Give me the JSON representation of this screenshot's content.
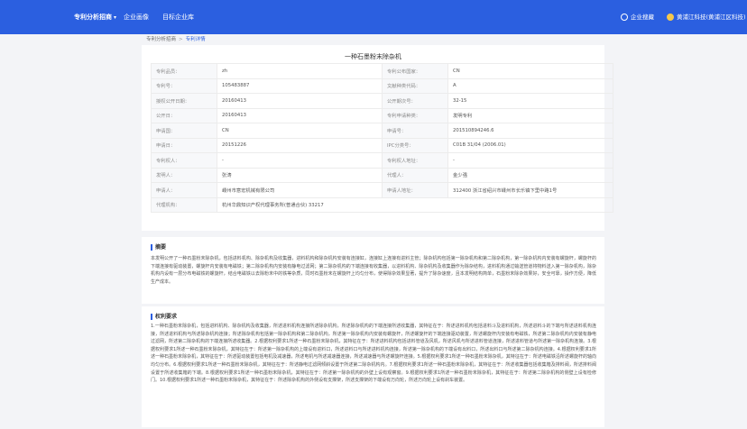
{
  "nav": {
    "items": [
      {
        "label": "专利分析招商"
      },
      {
        "label": "企业画像"
      },
      {
        "label": "目标企业库"
      }
    ],
    "right": {
      "favorites": "企业搜藏",
      "user": "黄浦江科技(黄浦江区科技)"
    }
  },
  "breadcrumb": {
    "parent": "专利分析招商",
    "current": "专利详情"
  },
  "detail": {
    "title": "一种石墨粉末除杂机",
    "rows": [
      [
        {
          "label": "专利品员：",
          "value": "zh"
        },
        {
          "label": "专利公布国家：",
          "value": "CN"
        }
      ],
      [
        {
          "label": "专利号：",
          "value": "105483887"
        },
        {
          "label": "文献种类代码：",
          "value": "A"
        }
      ],
      [
        {
          "label": "授权公开日期：",
          "value": "20160413"
        },
        {
          "label": "公开期次号：",
          "value": "32-15"
        }
      ],
      [
        {
          "label": "公开日：",
          "value": "20160413"
        },
        {
          "label": "专利申请种类：",
          "value": "发明专利"
        }
      ],
      [
        {
          "label": "申请国：",
          "value": "CN"
        },
        {
          "label": "申请号：",
          "value": "201510894246.6"
        }
      ],
      [
        {
          "label": "申请日：",
          "value": "20151226"
        },
        {
          "label": "IPC分类号：",
          "value": "C01B 31/04 (2006.01)"
        }
      ],
      [
        {
          "label": "专利权人：",
          "value": "-"
        },
        {
          "label": "专利权人地址：",
          "value": "-"
        }
      ],
      [
        {
          "label": "发明人：",
          "value": "张涛"
        },
        {
          "label": "代理人：",
          "value": "金少强"
        }
      ],
      [
        {
          "label": "申请人：",
          "value": "嵊州市意宏机械有限公司"
        },
        {
          "label": "申请人地址：",
          "value": "312400 浙江省绍兴市嵊州市长乐镇下里中路1号"
        }
      ]
    ],
    "agency_label": "代理机构：",
    "agency_value": "杭州华鼎知识产权代理事务所(普通合伙) 33217"
  },
  "abstract": {
    "title": "摘要",
    "text": "本发明公开了一种石墨粉末除杂机，包括进料机构、除杂机构及收集器，进料机构和除杂机构安装有连接缸，连接缸上连接有进料主管；除杂机构包括第一除杂机构和第二除杂机构，第一除杂机构内安装有螺旋杆，螺旋杆的下端连接有驱动装置，螺旋杆内安装有电磁铁；第二除杂机构内安装有静电过滤网；第二除杂机构的下端连接有收集器，以进料机构、除杂机构及收集器作为除杂结构，进料机构通过输送管道将物料送入第一除杂机构，除杂机构内设有一层分布电磁铁的螺旋杆，结合电磁铁以去除粉末中的铁等杂质，同时石墨粉末在螺旋杆上均匀分布，使得除杂效果显著，提升了除杂速度，且本发明结构简单，石墨粉末除杂效果好，安全可靠，操作方便，降低生产成本。"
  },
  "claims": {
    "title": "权利要求",
    "text": "1.一种石墨粉末除杂机，包括进料机构、除杂机构及收集器，所述进料机构连接所述除杂机构，所述除杂机构的下端连接所述收集器，其特征在于：所述进料机构包括进料斗及进料机构，所述进料斗的下端与所述进料机构连接，所述进料机构与所述除杂机构连接；所述除杂机构包括第一除杂机构和第二除杂机构，所述第一除杂机构内安装有螺旋杆，所述螺旋杆的下端连接驱动装置，所述螺旋杆内安装有电磁铁，所述第二除杂机构内安装有静电过滤网，所述第二除杂机构的下端连接所述收集器。2.根据权利要求1所述一种石墨粉末除杂机，其特征在于：所述进料机构包括进料管道及风机，所述风机与所述进料管道连接，所述进料管道与所述第一除杂机构连接。3.根据权利要求1所述一种石墨粉末除杂机，其特征在于：所述第一除杂机构的上端设有进料口，所述进料口与所述进料机构连接，所述第一除杂机构的下端设有出料口，所述出料口与所述第二除杂机构连接。4.根据权利要求1所述一种石墨粉末除杂机，其特征在于：所述驱动装置包括电机及减速器，所述电机与所述减速器连接，所述减速器与所述螺旋杆连接。5.根据权利要求1所述一种石墨粉末除杂机，其特征在于：所述电磁铁沿所述螺旋杆的轴向均匀分布。6.根据权利要求1所述一种石墨粉末除杂机，其特征在于：所述静电过滤网倾斜设置于所述第二除杂机构内。7.根据权利要求1所述一种石墨粉末除杂机，其特征在于：所述收集器包括收集箱及排料阀，所述排料阀设置于所述收集箱的下端。8.根据权利要求1所述一种石墨粉末除杂机，其特征在于：所述第一除杂机构的外壁上设有观察窗。9.根据权利要求1所述一种石墨粉末除杂机，其特征在于：所述第二除杂机构的侧壁上设有检修门。10.根据权利要求1所述一种石墨粉末除杂机，其特征在于：所述除杂机构的外侧设有支撑架，所述支撑架的下端设有万向轮，所述万向轮上设有刹车装置。"
  }
}
